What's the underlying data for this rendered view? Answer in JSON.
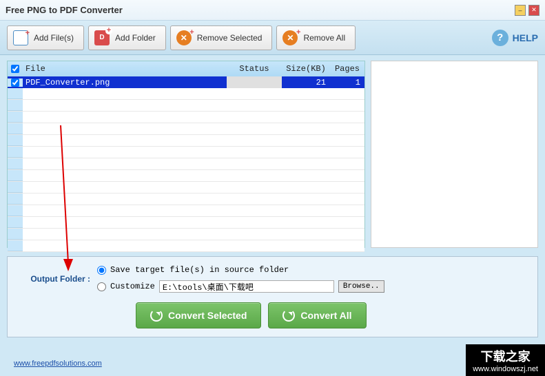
{
  "window": {
    "title": "Free PNG to PDF Converter"
  },
  "toolbar": {
    "add_files": "Add File(s)",
    "add_folder": "Add Folder",
    "remove_selected": "Remove Selected",
    "remove_all": "Remove All",
    "help": "HELP"
  },
  "table": {
    "headers": {
      "file": "File",
      "status": "Status",
      "size": "Size(KB)",
      "pages": "Pages"
    },
    "rows": [
      {
        "checked": true,
        "file": "PDF_Converter.png",
        "status": "",
        "size": "21",
        "pages": "1",
        "selected": true
      }
    ]
  },
  "output": {
    "label": "Output Folder :",
    "option_source": "Save target file(s) in source folder",
    "option_customize": "Customize",
    "customize_path": "E:\\tools\\桌面\\下载吧",
    "browse": "Browse..",
    "selected": "source",
    "convert_selected": "Convert Selected",
    "convert_all": "Convert All"
  },
  "footer": {
    "link": "www.freepdfsolutions.com"
  },
  "watermark": {
    "title": "下载之家",
    "url": "www.windowszj.net"
  }
}
